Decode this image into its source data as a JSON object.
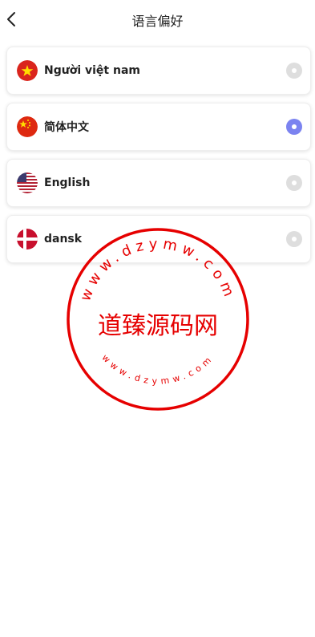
{
  "header": {
    "title": "语言偏好",
    "back_icon": "chevron-left-icon"
  },
  "colors": {
    "selected": "#7b83f0",
    "unselected": "#dedede",
    "stamp": "#e60000"
  },
  "languages": [
    {
      "label": "Người việt nam",
      "flag": "vietnam-flag-icon",
      "selected": false
    },
    {
      "label": "简体中文",
      "flag": "china-flag-icon",
      "selected": true
    },
    {
      "label": "English",
      "flag": "usa-flag-icon",
      "selected": false
    },
    {
      "label": "dansk",
      "flag": "denmark-flag-icon",
      "selected": false
    }
  ],
  "watermark": {
    "center_text": "道臻源码网",
    "top_text": "www.dzymw.com",
    "bottom_text": "www.dzymw.com"
  }
}
